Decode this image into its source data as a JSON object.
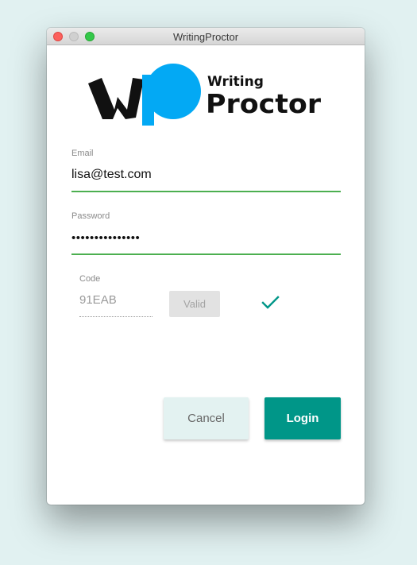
{
  "window": {
    "title": "WritingProctor"
  },
  "logo": {
    "line1": "Writing",
    "line2": "Proctor",
    "mark_letters": "Wp",
    "colors": {
      "mark": "#111111",
      "circle": "#03a9f4"
    }
  },
  "form": {
    "email": {
      "label": "Email",
      "value": "lisa@test.com"
    },
    "password": {
      "label": "Password",
      "value": "•••••••••••••••"
    },
    "code": {
      "label": "Code",
      "value": "91EAB",
      "validate_label": "Valid",
      "status_icon": "checkmark-icon"
    }
  },
  "actions": {
    "cancel_label": "Cancel",
    "login_label": "Login"
  },
  "colors": {
    "accent": "#009688",
    "field_underline": "#4caf50",
    "check": "#009688",
    "background": "#e1f1f1"
  }
}
